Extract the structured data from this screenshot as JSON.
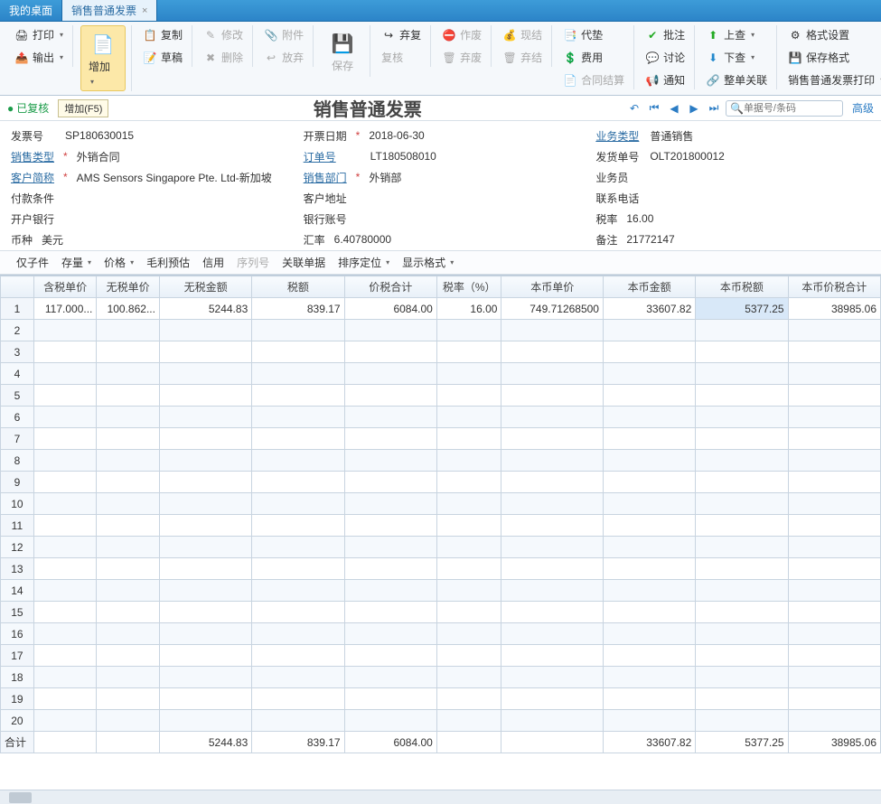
{
  "tabs": [
    {
      "label": "我的桌面",
      "closable": false
    },
    {
      "label": "销售普通发票",
      "closable": true
    }
  ],
  "ribbon": {
    "print": "打印",
    "output": "输出",
    "add": "增加",
    "add_tip": "增加(F5)",
    "copy": "复制",
    "edit": "修改",
    "attach": "附件",
    "draft": "草稿",
    "delete": "删除",
    "release": "放弃",
    "save": "保存",
    "reaudit": "弃复",
    "audit": "复核",
    "invalid": "作废",
    "cash": "现结",
    "advance": "代垫",
    "fee": "费用",
    "discard": "弃废",
    "discard2": "弃结",
    "contract": "合同结算",
    "approve": "批注",
    "discuss": "讨论",
    "notify": "通知",
    "up": "上查",
    "down": "下查",
    "relation": "整单关联",
    "format": "格式设置",
    "saveformat": "保存格式",
    "printset": "销售普通发票打印"
  },
  "status": {
    "text": "已复核",
    "tooltip": "增加(F5)"
  },
  "title": "销售普通发票",
  "search_placeholder": "单据号/条码",
  "advanced": "高级",
  "nav_icons": {
    "undo": "↶",
    "first": "⏮",
    "prev": "◀",
    "next": "▶",
    "last": "⏭"
  },
  "formLabels": {
    "invoiceNo": "发票号",
    "saleType": "销售类型",
    "custAbbr": "客户简称",
    "payTerm": "付款条件",
    "bank": "开户银行",
    "currency": "币种",
    "invoiceDate": "开票日期",
    "orderNo": "订单号",
    "saleDept": "销售部门",
    "custAddr": "客户地址",
    "bankAcct": "银行账号",
    "exRate": "汇率",
    "bizType": "业务类型",
    "shipNo": "发货单号",
    "salesman": "业务员",
    "phone": "联系电话",
    "taxRate": "税率",
    "remark": "备注"
  },
  "form": {
    "invoiceNo": "SP180630015",
    "saleType": "外销合同",
    "custAbbr": "AMS Sensors Singapore Pte. Ltd-新加坡",
    "payTerm": "",
    "bank": "",
    "currency": "美元",
    "invoiceDate": "2018-06-30",
    "orderNo": "LT180508010",
    "saleDept": "外销部",
    "custAddr": "",
    "bankAcct": "",
    "exRate": "6.40780000",
    "bizType": "普通销售",
    "shipNo": "OLT201800012",
    "salesman": "",
    "phone": "",
    "taxRate": "16.00",
    "remark": "21772147"
  },
  "subToolbar": {
    "child": "仅子件",
    "stock": "存量",
    "price": "价格",
    "profit": "毛利预估",
    "credit": "信用",
    "serial": "序列号",
    "reldoc": "关联单据",
    "sort": "排序定位",
    "display": "显示格式"
  },
  "grid": {
    "headers": [
      "含税单价",
      "无税单价",
      "无税金额",
      "税额",
      "价税合计",
      "税率（%）",
      "本币单价",
      "本币金额",
      "本币税额",
      "本币价税合计"
    ],
    "row1": [
      "117.000...",
      "100.862...",
      "5244.83",
      "839.17",
      "6084.00",
      "16.00",
      "749.71268500",
      "33607.82",
      "5377.25",
      "38985.06"
    ],
    "totalLabel": "合计",
    "totals": [
      "",
      "",
      "5244.83",
      "839.17",
      "6084.00",
      "",
      "",
      "33607.82",
      "5377.25",
      "38985.06"
    ]
  }
}
